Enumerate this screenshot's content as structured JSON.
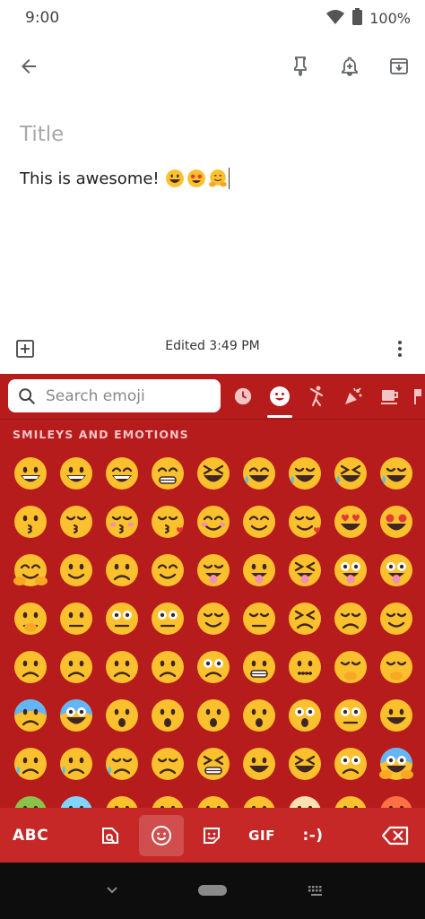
{
  "status_bar": {
    "time": "9:00",
    "battery": "100%"
  },
  "note": {
    "title_placeholder": "Title",
    "body_text": "This is awesome!",
    "edited": "Edited 3:49 PM"
  },
  "keyboard": {
    "search_placeholder": "Search emoji",
    "section_title": "SMILEYS AND EMOTIONS",
    "keys": {
      "abc": "ABC",
      "gif": "GIF",
      "emoticon": ":-)"
    },
    "colors": {
      "keyboard_bg": "#b71c1c",
      "bottom_bar": "#c62828"
    }
  }
}
